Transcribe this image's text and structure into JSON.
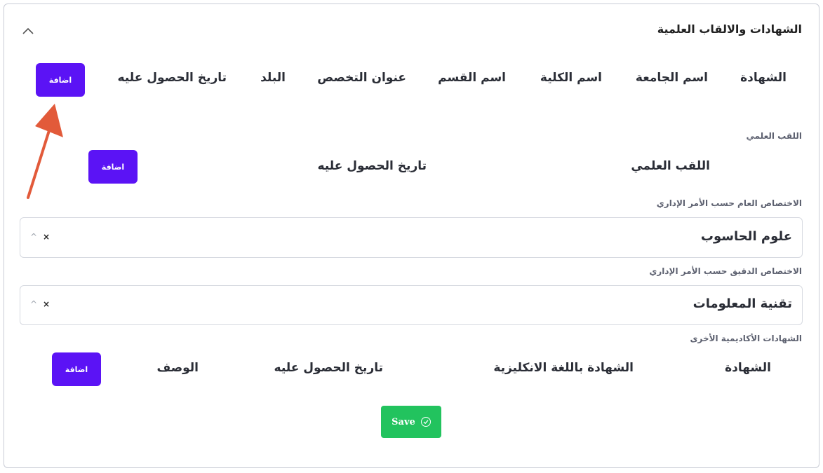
{
  "section": {
    "title": "الشهادات والالقاب العلمية"
  },
  "certificates_table": {
    "columns": [
      "الشهادة",
      "اسم الجامعة",
      "اسم الكلية",
      "اسم القسم",
      "عنوان التخصص",
      "البلد",
      "تاريخ الحصول عليه"
    ],
    "add_label": "اضافة"
  },
  "academic_title": {
    "label": "اللقب العلمي",
    "columns": [
      "اللقب العلمي",
      "تاريخ الحصول عليه"
    ],
    "add_label": "اضافة"
  },
  "general_specialization": {
    "label": "الاختصاص العام حسب الأمر الإداري",
    "value": "علوم الحاسوب",
    "clear_glyph": "×",
    "caret_glyph": "^"
  },
  "precise_specialization": {
    "label": "الاختصاص الدقيق حسب الأمر الإداري",
    "value": "تقنية المعلومات",
    "clear_glyph": "×",
    "caret_glyph": "^"
  },
  "other_certificates": {
    "label": "الشهادات الأكاديمية الأخرى",
    "columns": [
      "الشهادة",
      "الشهادة باللغة الانكليزية",
      "تاريخ الحصول عليه",
      "الوصف"
    ],
    "add_label": "اضافة"
  },
  "save": {
    "label": "Save"
  },
  "colors": {
    "primary": "#5b13f5",
    "success": "#22c35e",
    "annotation_arrow": "#e25a3a"
  },
  "icons": [
    "chevron-up-icon",
    "close-icon",
    "caret-up-icon",
    "check-circle-icon",
    "annotation-arrow"
  ]
}
